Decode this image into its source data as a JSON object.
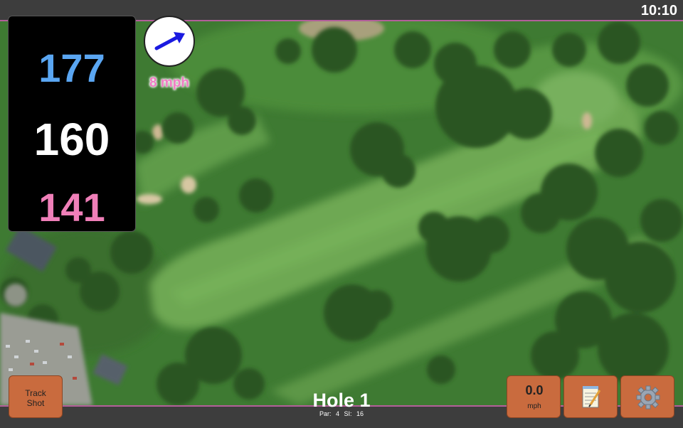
{
  "status_bar": {
    "time": "10:10"
  },
  "distances": {
    "back": "177",
    "middle": "160",
    "front": "141"
  },
  "wind": {
    "speed_label": "8 mph",
    "direction_icon": "arrow-icon",
    "direction_deg": 70
  },
  "hole": {
    "title": "Hole 1",
    "par_label": "Par: 4",
    "si_label": "SI: 16"
  },
  "buttons": {
    "track_line1": "Track",
    "track_line2": "Shot",
    "speed_value": "0.0",
    "speed_unit": "mph",
    "notes_icon": "notepad-icon",
    "settings_icon": "gear-icon"
  },
  "colors": {
    "back_distance": "#5aa6f2",
    "middle_distance": "#ffffff",
    "front_distance": "#ef7fb8",
    "button_bg": "#c96b3e",
    "bar_accent": "#b35f9a"
  }
}
